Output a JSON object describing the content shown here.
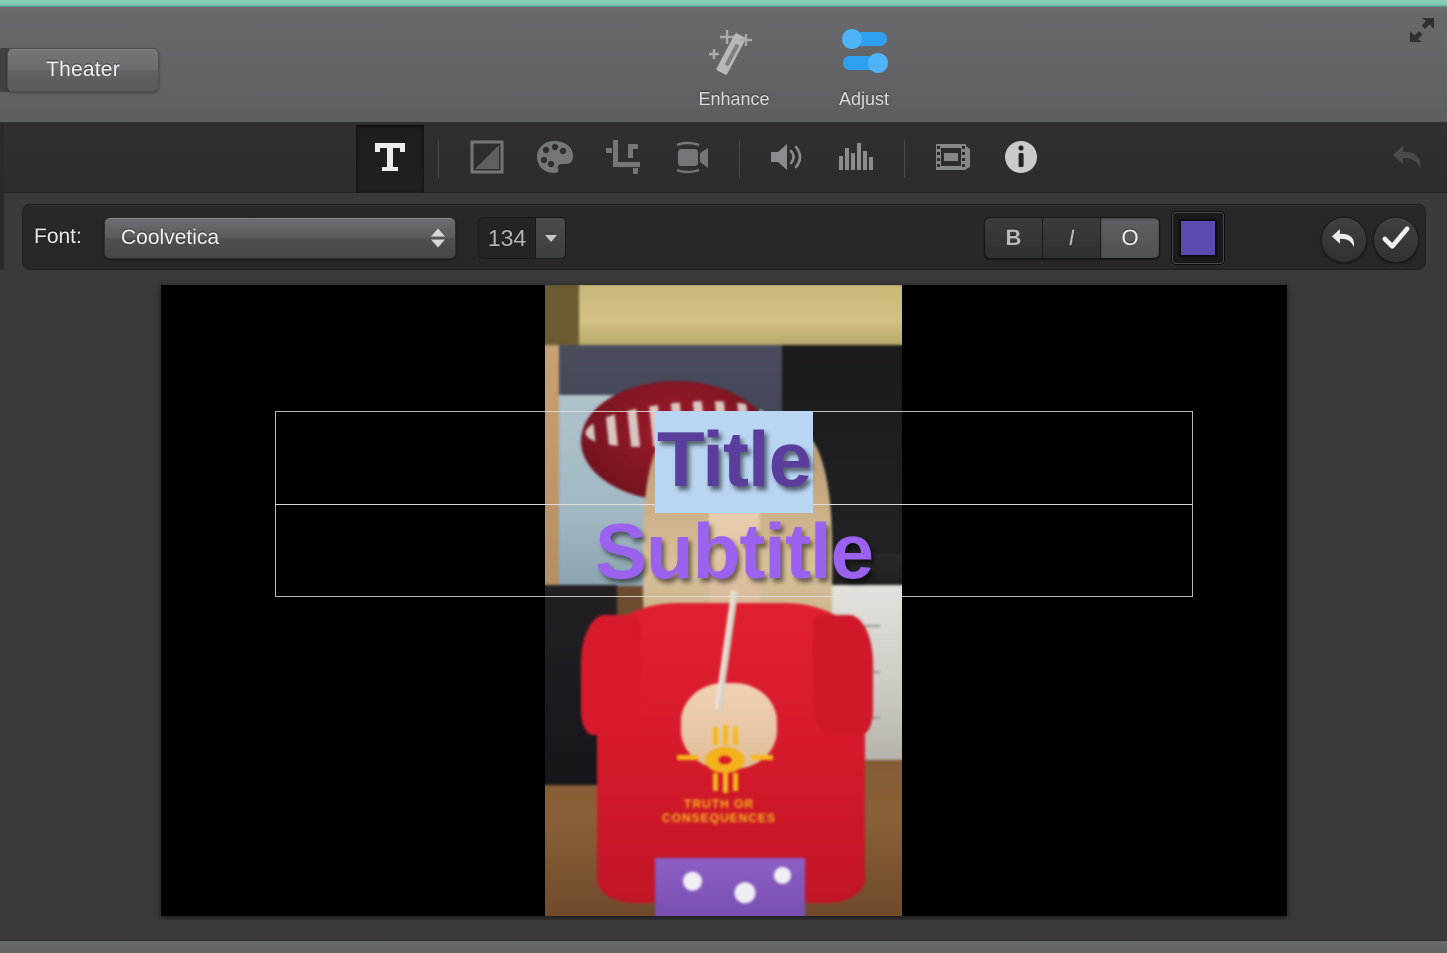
{
  "window": {
    "theater_button": "Theater",
    "expand_icon": "fullscreen-expand-icon"
  },
  "top_toolbar": {
    "items": [
      {
        "label": "Enhance",
        "icon": "magic-wand-icon",
        "active": false
      },
      {
        "label": "Adjust",
        "icon": "sliders-icon",
        "active": true
      }
    ]
  },
  "icon_toolbar": {
    "items": [
      {
        "name": "titles-text-tool",
        "icon": "text-T-icon",
        "active": true
      },
      {
        "name": "color-balance-tool",
        "icon": "half-filled-square-icon",
        "active": false
      },
      {
        "name": "color-correction-tool",
        "icon": "paint-palette-icon",
        "active": false
      },
      {
        "name": "crop-tool",
        "icon": "crop-icon",
        "active": false
      },
      {
        "name": "stabilization-tool",
        "icon": "video-camera-icon",
        "active": false
      },
      {
        "name": "volume-tool",
        "icon": "speaker-icon",
        "active": false
      },
      {
        "name": "noise-reduction-tool",
        "icon": "equalizer-bars-icon",
        "active": false
      },
      {
        "name": "clip-filter-tool",
        "icon": "film-strip-icon",
        "active": false
      },
      {
        "name": "info-tool",
        "icon": "info-circle-icon",
        "active": false
      }
    ],
    "undo": {
      "name": "revert-to-original",
      "icon": "undo-arrow-icon"
    }
  },
  "font_bar": {
    "font_label": "Font:",
    "font_name": "Coolvetica",
    "font_size": "134",
    "style_buttons": [
      {
        "label": "B",
        "name": "bold-button",
        "active": false
      },
      {
        "label": "I",
        "name": "italic-button",
        "active": false
      },
      {
        "label": "O",
        "name": "outline-button",
        "active": true
      }
    ],
    "color_swatch": "#5b4ab0",
    "undo_button_icon": "undo-arrow-icon",
    "confirm_button_icon": "checkmark-icon"
  },
  "preview": {
    "title_text": "Title",
    "subtitle_text": "Subtitle",
    "title_color": "#5b3d9e",
    "subtitle_color": "#9a62ee",
    "title_selection_color": "#b9d5f2",
    "shirt_text": "TRUTH OR CONSEQUENCES"
  }
}
